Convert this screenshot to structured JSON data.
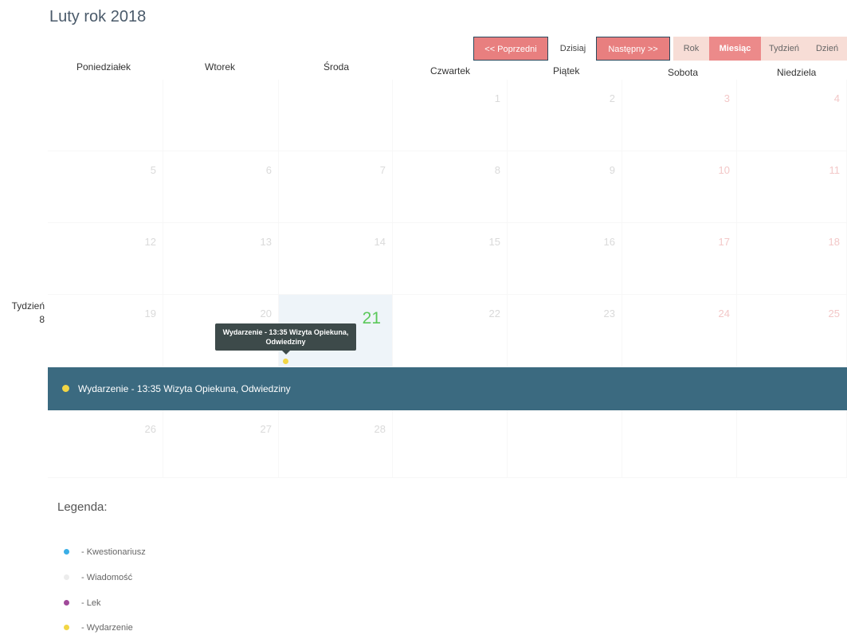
{
  "header": {
    "title": "Luty rok 2018"
  },
  "nav": {
    "prev": "<< Poprzedni",
    "today": "Dzisiaj",
    "next": "Następny >>",
    "year": "Rok",
    "month": "Miesiąc",
    "week": "Tydzień",
    "day": "Dzień"
  },
  "weekdays": [
    "Poniedziałek",
    "Wtorek",
    "Środa",
    "Czwartek",
    "Piątek",
    "Sobota",
    "Niedziela"
  ],
  "weeks": [
    [
      "",
      "",
      "",
      "1",
      "2",
      "3",
      "4"
    ],
    [
      "5",
      "6",
      "7",
      "8",
      "9",
      "10",
      "11"
    ],
    [
      "12",
      "13",
      "14",
      "15",
      "16",
      "17",
      "18"
    ],
    [
      "19",
      "20",
      "21",
      "22",
      "23",
      "24",
      "25"
    ],
    [
      "26",
      "27",
      "28",
      "",
      "",
      "",
      ""
    ]
  ],
  "week_label": {
    "word": "Tydzień",
    "number": "8"
  },
  "event": {
    "tooltip": "Wydarzenie - 13:35 Wizyta Opiekuna, Odwiedziny",
    "bar_text": "Wydarzenie - 13:35 Wizyta Opiekuna, Odwiedziny"
  },
  "legend": {
    "title": "Legenda:",
    "items": [
      {
        "label": "- Kwestionariusz",
        "color": "#3aaee6"
      },
      {
        "label": "- Wiadomość",
        "color": "#ececec"
      },
      {
        "label": "- Lek",
        "color": "#a04a9a"
      },
      {
        "label": "- Wydarzenie",
        "color": "#f2d645"
      }
    ]
  },
  "colors": {
    "accent_red": "#e87f7f",
    "event_bar": "#3b6a80",
    "today_number": "#5ac85a",
    "event_dot": "#f2d645"
  }
}
